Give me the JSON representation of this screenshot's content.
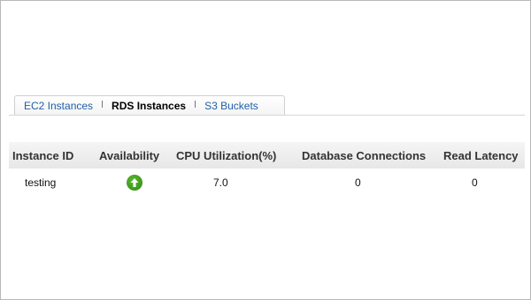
{
  "tabs": [
    {
      "label": "EC2 Instances",
      "active": false
    },
    {
      "label": "RDS Instances",
      "active": true
    },
    {
      "label": "S3 Buckets",
      "active": false
    }
  ],
  "table": {
    "columns": [
      "Instance ID",
      "Availability",
      "CPU Utilization(%)",
      "Database Connections",
      "Read Latency"
    ],
    "rows": [
      {
        "instance_id": "testing",
        "availability_icon": "up-arrow-icon",
        "availability_color": "#3a9a1a",
        "cpu": "7.0",
        "connections": "0",
        "read_latency": "0"
      }
    ]
  }
}
